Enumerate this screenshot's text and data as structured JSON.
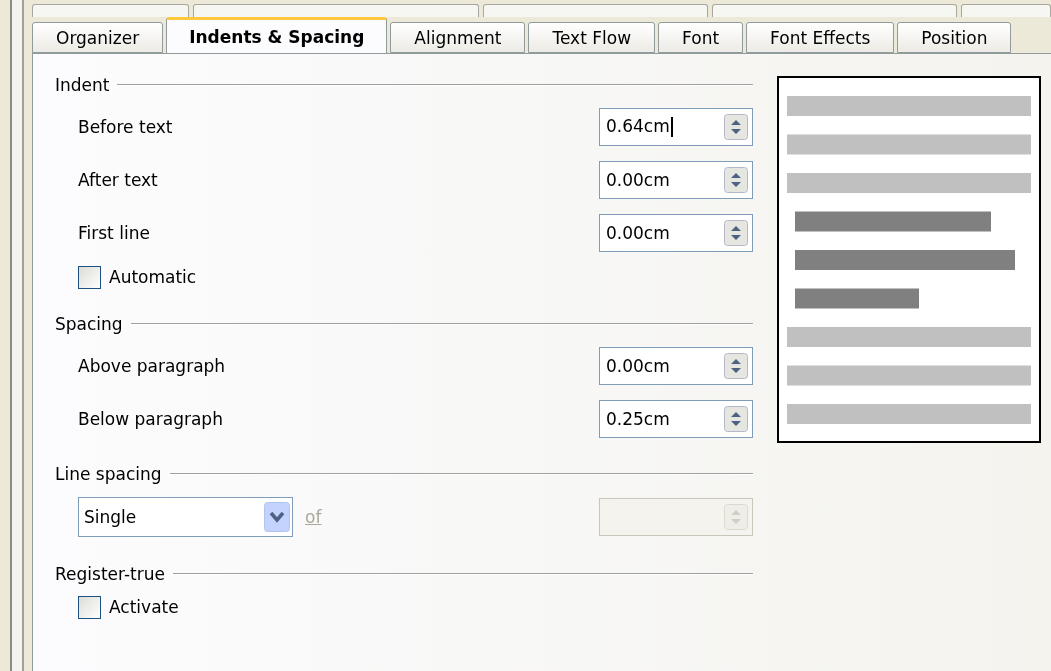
{
  "tabs": [
    {
      "label": "Organizer",
      "selected": false
    },
    {
      "label": "Indents & Spacing",
      "selected": true
    },
    {
      "label": "Alignment",
      "selected": false
    },
    {
      "label": "Text Flow",
      "selected": false
    },
    {
      "label": "Font",
      "selected": false
    },
    {
      "label": "Font Effects",
      "selected": false
    },
    {
      "label": "Position",
      "selected": false
    }
  ],
  "sections": [
    {
      "title": "Indent",
      "rows": [
        {
          "kind": "spin",
          "label": "Before text",
          "value": "0.64cm",
          "focused": true
        },
        {
          "kind": "spin",
          "label": "After text",
          "value": "0.00cm",
          "focused": false
        },
        {
          "kind": "spin",
          "label": "First line",
          "value": "0.00cm",
          "focused": false
        },
        {
          "kind": "check",
          "label": "Automatic",
          "checked": false
        }
      ]
    },
    {
      "title": "Spacing",
      "rows": [
        {
          "kind": "spin",
          "label": "Above paragraph",
          "value": "0.00cm",
          "focused": false
        },
        {
          "kind": "spin",
          "label": "Below paragraph",
          "value": "0.25cm",
          "focused": false
        }
      ]
    },
    {
      "title": "Line spacing",
      "rows": [
        {
          "kind": "select",
          "value": "Single",
          "of_label": "of",
          "disabled": true
        }
      ]
    },
    {
      "title": "Register-true",
      "rows": [
        {
          "kind": "check",
          "label": "Activate",
          "checked": false
        }
      ]
    }
  ]
}
